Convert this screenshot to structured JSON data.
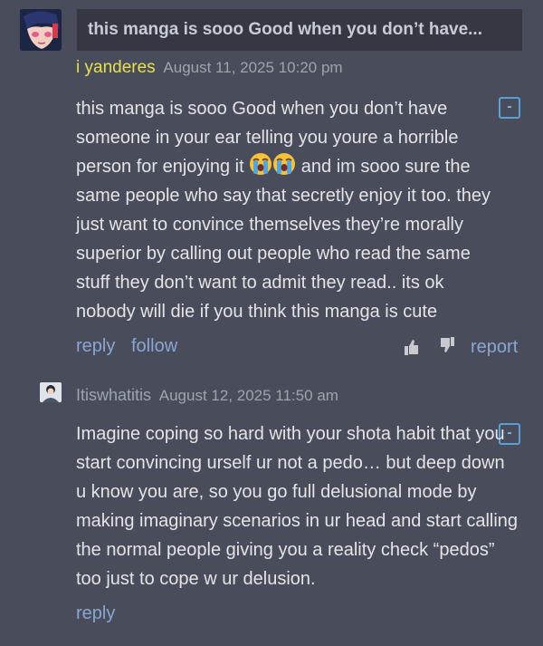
{
  "comments": [
    {
      "title": "this manga is sooo Good when you don’t have...",
      "username": "i yanderes",
      "date": "August 11, 2025 10:20 pm",
      "collapse_label": "-",
      "body_before_emoji": "this manga is sooo Good when you don’t have someone in your ear telling you youre a horrible person for enjoying it",
      "emoji": [
        "loudly-crying-face",
        "loudly-crying-face"
      ],
      "body_after_emoji": " and im sooo sure the same people who say that secretly enjoy it too. they just want to convince themselves they’re morally superior by calling out people who read the same stuff they don’t want to admit they read.. its ok nobody will die if you think this manga is cute",
      "actions": {
        "reply": "reply",
        "follow": "follow",
        "report": "report"
      },
      "vote_icons": [
        "thumbs-up-icon",
        "thumbs-down-icon"
      ]
    },
    {
      "username": "Itiswhatitis",
      "date": "August 12, 2025 11:50 am",
      "collapse_label": "-",
      "body": "Imagine coping so hard with your shota habit that you start convincing urself ur not a pedo… but deep down u know you are, so you go full delusional mode by making imaginary scenarios in ur head and start calling the normal people giving you a reality check “pedos” too just to cope w ur delusion.",
      "actions": {
        "reply": "reply"
      }
    }
  ],
  "colors": {
    "background": "#494d5b",
    "title_bar": "#353843",
    "username_highlight": "#e5e24c",
    "link": "#8aa6d0",
    "toggle_border": "#5aa0d6"
  }
}
